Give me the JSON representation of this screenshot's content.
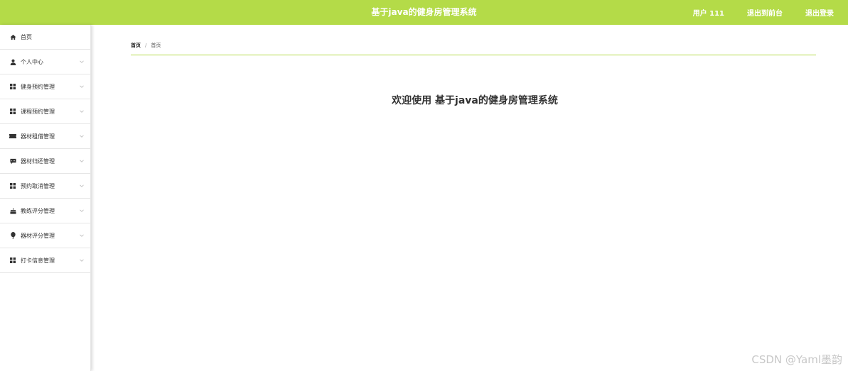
{
  "header": {
    "title": "基于java的健身房管理系统",
    "user_label": "用户 111",
    "back_admin_label": "退出到前台",
    "logout_label": "退出登录",
    "background_color": "#b4db48"
  },
  "sidebar": {
    "items": [
      {
        "label": "首页",
        "icon": "home-icon",
        "has_chevron": false
      },
      {
        "label": "个人中心",
        "icon": "user-icon",
        "has_chevron": true
      },
      {
        "label": "健身预约管理",
        "icon": "grid-icon",
        "has_chevron": true
      },
      {
        "label": "课程预约管理",
        "icon": "grid-icon",
        "has_chevron": true
      },
      {
        "label": "器材租借管理",
        "icon": "ticket-icon",
        "has_chevron": true
      },
      {
        "label": "器材归还管理",
        "icon": "message-icon",
        "has_chevron": true
      },
      {
        "label": "预约取消管理",
        "icon": "grid-icon",
        "has_chevron": true
      },
      {
        "label": "教练评分管理",
        "icon": "cake-icon",
        "has_chevron": true
      },
      {
        "label": "器材评分管理",
        "icon": "balloon-icon",
        "has_chevron": true
      },
      {
        "label": "打卡信息管理",
        "icon": "grid-icon",
        "has_chevron": true
      }
    ]
  },
  "main": {
    "breadcrumb": {
      "home": "首页",
      "separator": "/",
      "current": "首页"
    },
    "welcome": "欢迎使用 基于java的健身房管理系统",
    "accent_color": "#b4db48"
  },
  "watermark": "CSDN @Yaml墨韵"
}
